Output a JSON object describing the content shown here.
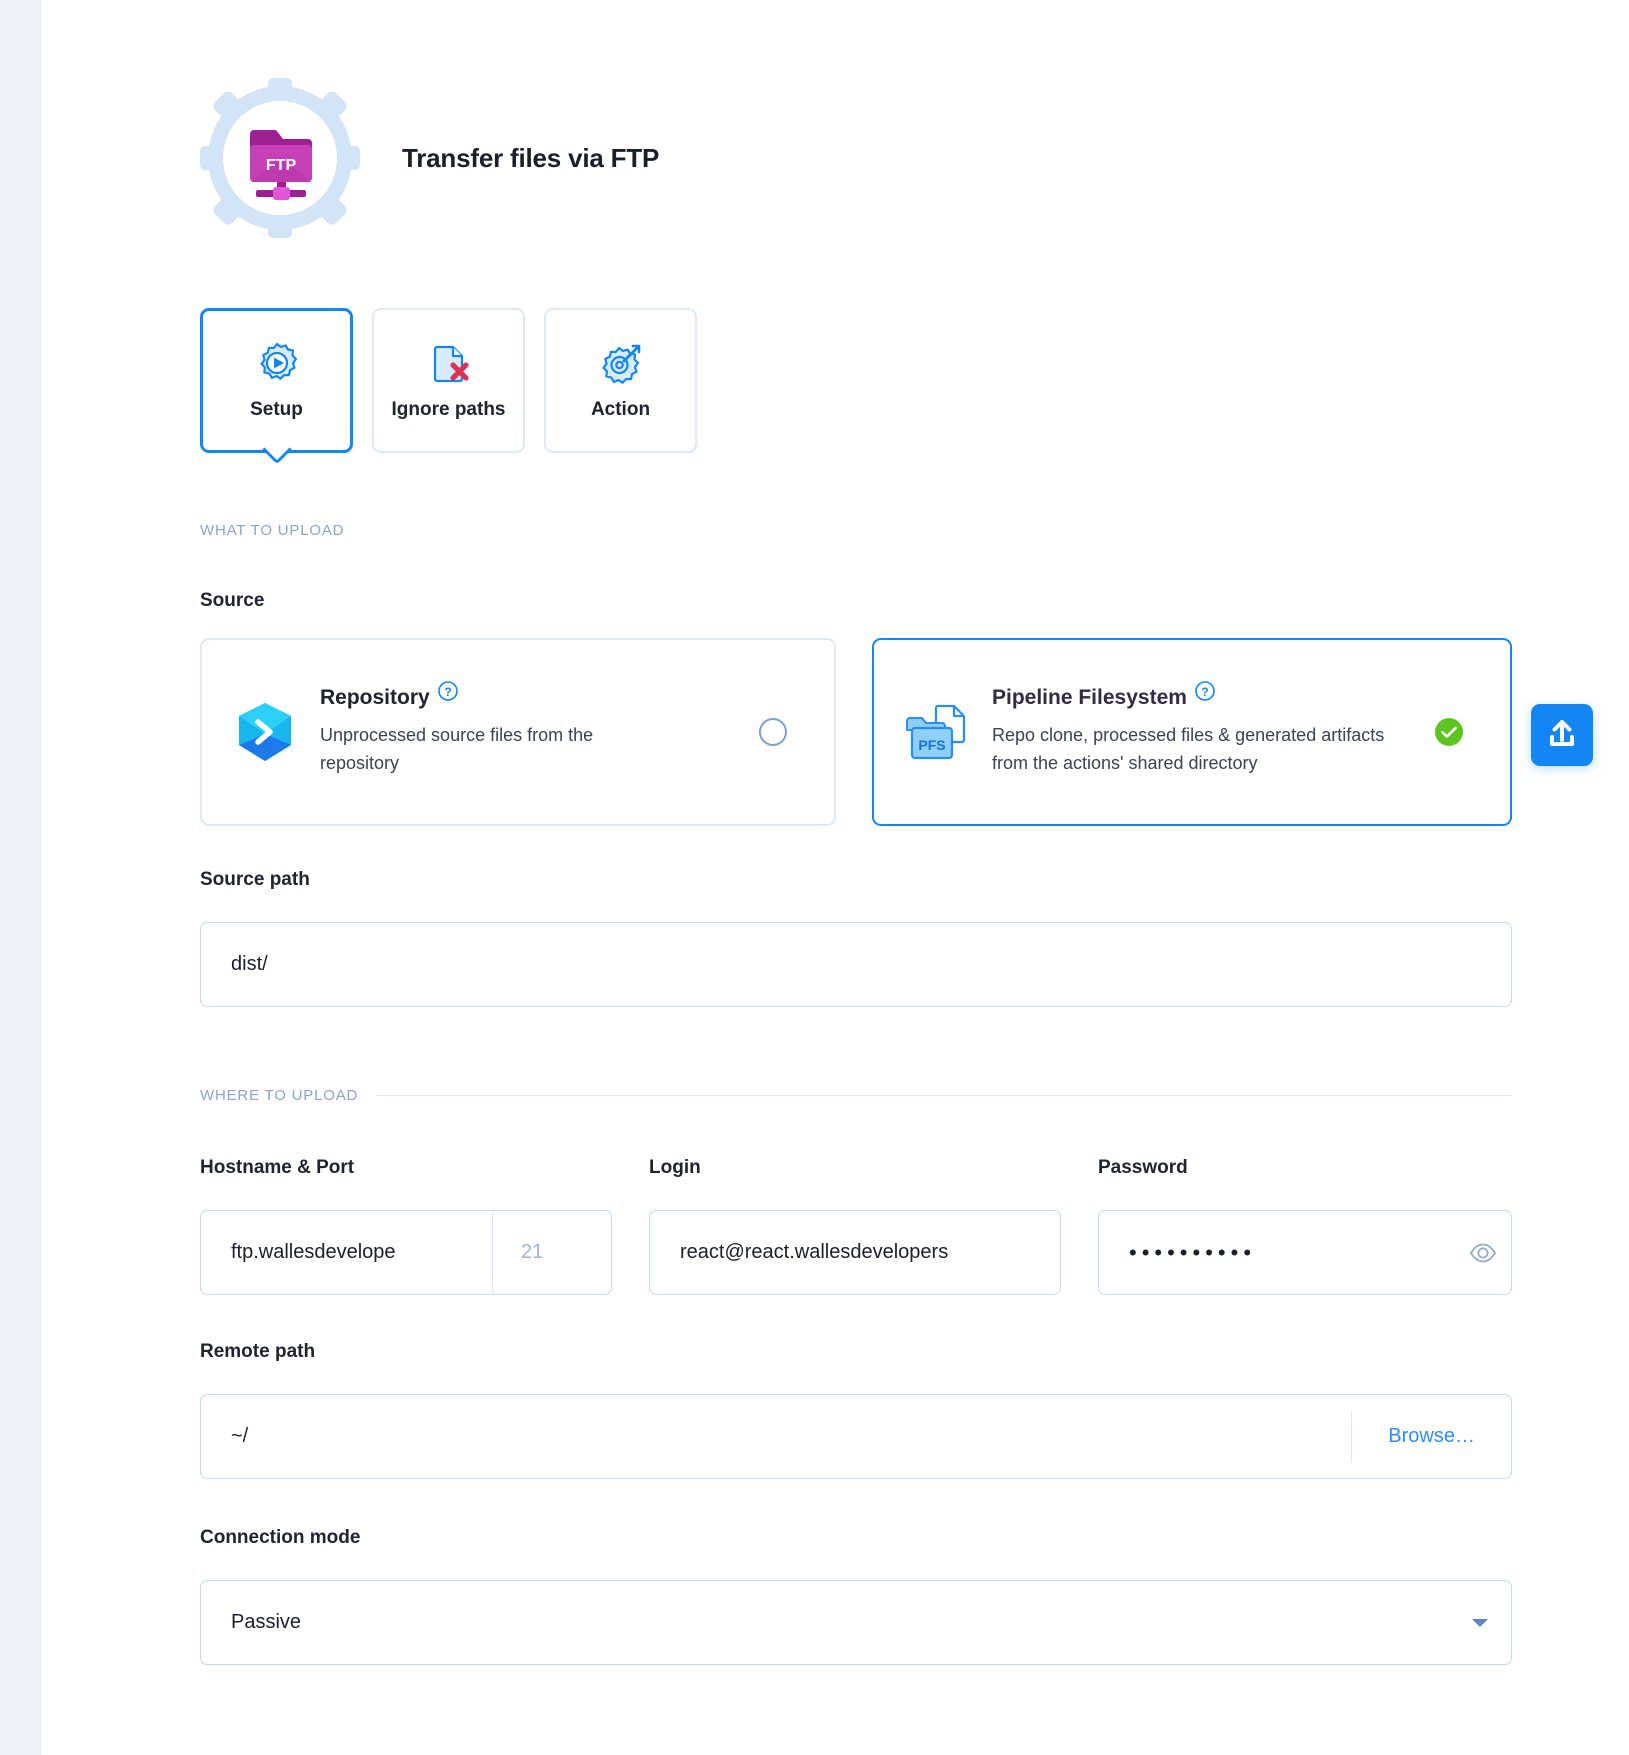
{
  "header": {
    "title": "Transfer files via FTP",
    "logo_text": "FTP",
    "logo_icon": "ftp-folder-icon",
    "badge_icon": "gear-badge-icon"
  },
  "tabs": [
    {
      "label": "Setup",
      "icon": "play-gear-icon",
      "active": true
    },
    {
      "label": "Ignore paths",
      "icon": "file-remove-icon",
      "active": false
    },
    {
      "label": "Action",
      "icon": "gear-wrench-icon",
      "active": false
    }
  ],
  "what_to_upload": {
    "caption": "WHAT TO UPLOAD",
    "source_label": "Source",
    "sources": [
      {
        "title": "Repository",
        "description": "Unprocessed source files from the repository",
        "icon": "repository-chevron-icon",
        "help_icon": "question-mark-icon",
        "selected": false,
        "state_icon": "radio-unchecked-icon"
      },
      {
        "title": "Pipeline Filesystem",
        "description": "Repo clone, processed files & generated artifacts from the actions' shared directory",
        "icon": "pfs-folder-icon",
        "icon_text": "PFS",
        "help_icon": "question-mark-icon",
        "selected": true,
        "state_icon": "check-circle-icon"
      }
    ],
    "source_path_label": "Source path",
    "source_path_value": "dist/",
    "upload_button_icon": "upload-icon"
  },
  "where_to_upload": {
    "caption": "WHERE TO UPLOAD",
    "hostname_label": "Hostname & Port",
    "hostname_value": "ftp.wallesdevelope",
    "port_placeholder": "21",
    "login_label": "Login",
    "login_value": "react@react.wallesdevelopers",
    "password_label": "Password",
    "password_value": "••••••••••",
    "password_toggle_icon": "eye-icon",
    "remote_path_label": "Remote path",
    "remote_path_value": "~/",
    "browse_label": "Browse…",
    "connection_mode_label": "Connection mode",
    "connection_mode_value": "Passive",
    "connection_mode_caret": "chevron-down-icon"
  },
  "colors": {
    "accent": "#1485f5",
    "success": "#5cc521",
    "caption": "#8aa5cc",
    "border": "#c7d9f0"
  }
}
